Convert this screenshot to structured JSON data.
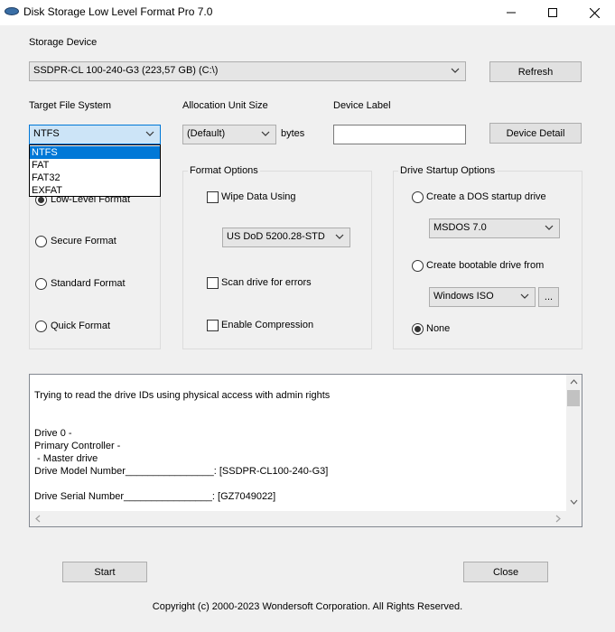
{
  "window": {
    "title": "Disk Storage Low Level Format Pro 7.0",
    "minimize_glyph": "—",
    "maximize_glyph": "☐",
    "close_glyph": "✕"
  },
  "storage": {
    "label": "Storage Device",
    "selected": "SSDPR-CL 100-240-G3 (223,57 GB) (C:\\)",
    "refresh_label": "Refresh"
  },
  "target_fs": {
    "label": "Target File System",
    "selected": "NTFS",
    "options": [
      "NTFS",
      "FAT",
      "FAT32",
      "EXFAT"
    ],
    "highlighted_index": 0
  },
  "allocation": {
    "label": "Allocation Unit Size",
    "selected": "(Default)",
    "unit": "bytes"
  },
  "device_label": {
    "label": "Device Label",
    "value": "",
    "detail_button": "Device Detail"
  },
  "format_type": {
    "options": [
      {
        "label": "Low-Level Format",
        "checked": true
      },
      {
        "label": "Secure Format",
        "checked": false
      },
      {
        "label": "Standard Format",
        "checked": false
      },
      {
        "label": "Quick Format",
        "checked": false
      }
    ]
  },
  "format_options": {
    "title": "Format Options",
    "wipe_label": "Wipe Data Using",
    "wipe_checked": false,
    "wipe_method": "US DoD 5200.28-STD",
    "scan_label": "Scan drive for errors",
    "scan_checked": false,
    "compression_label": "Enable Compression",
    "compression_checked": false
  },
  "startup": {
    "title": "Drive Startup Options",
    "dos_label": "Create a DOS startup drive",
    "dos_version": "MSDOS 7.0",
    "bootable_label": "Create bootable drive from",
    "bootable_source": "Windows ISO",
    "browse_label": "...",
    "none_label": "None",
    "selected": "none"
  },
  "log": {
    "lines": [
      "Trying to read the drive IDs using physical access with admin rights",
      "",
      "",
      "Drive 0 -",
      "Primary Controller -",
      " - Master drive",
      "Drive Model Number________________: [SSDPR-CL100-240-G3]",
      "",
      "Drive Serial Number________________: [GZ7049022]"
    ]
  },
  "footer": {
    "start_label": "Start",
    "close_label": "Close",
    "copyright": "Copyright (c) 2000-2023 Wondersoft Corporation. All Rights Reserved."
  },
  "colors": {
    "selection": "#0078d7",
    "window_bg": "#f0f0f0"
  }
}
